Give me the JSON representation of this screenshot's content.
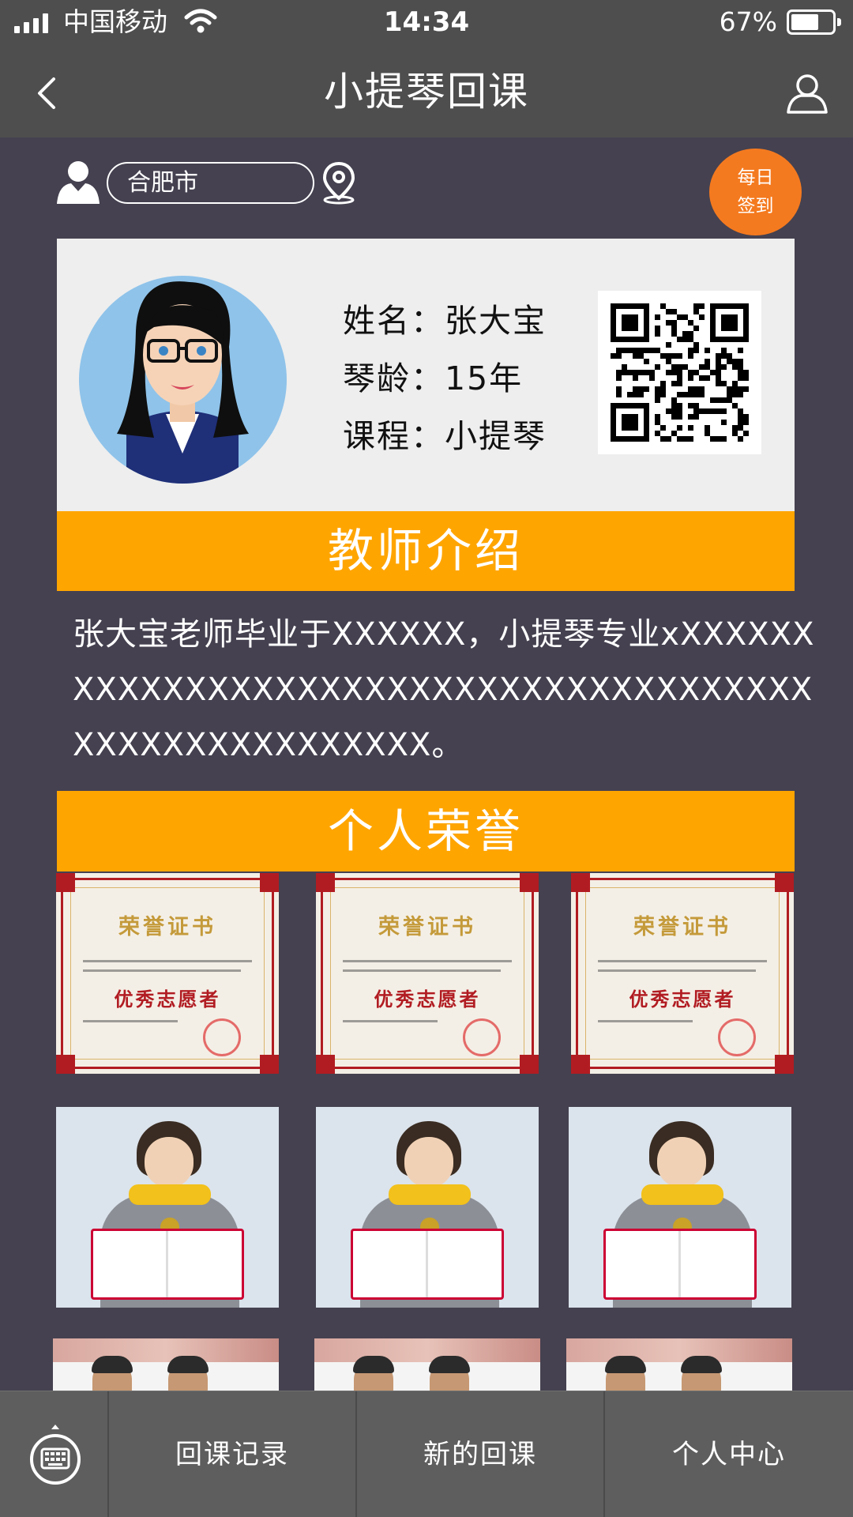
{
  "status_bar": {
    "carrier": "中国移动",
    "time": "14:34",
    "battery": "67%",
    "battery_level": 0.67
  },
  "nav": {
    "title": "小提琴回课",
    "back_icon": "chevron-left-icon",
    "profile_icon": "user-outline-icon"
  },
  "location": {
    "city": "合肥市",
    "user_icon": "user-solid-icon",
    "pin_icon": "location-pin-icon"
  },
  "checkin": {
    "line1": "每日",
    "line2": "签到",
    "color": "#f47a1f"
  },
  "teacher": {
    "name_label": "姓名：",
    "name": "张大宝",
    "age_label": "琴龄：",
    "age": "15年",
    "course_label": "课程：",
    "course": "小提琴"
  },
  "intro": {
    "header": "教师介绍",
    "text": "张大宝老师毕业于XXXXXX，小提琴专业xXXXXXXXXXXXXXXXXXXXXXXXXXXXXXXXXXXXXXXXXXXXXXXXXXXXXXXX。"
  },
  "honors": {
    "header": "个人荣誉",
    "certificate_title": "荣誉证书",
    "certificate_award": "优秀志愿者"
  },
  "tabs": {
    "keyboard_icon": "keyboard-icon",
    "tab1": "回课记录",
    "tab2": "新的回课",
    "tab3": "个人中心"
  },
  "colors": {
    "background": "#454150",
    "bar": "#4e4e4e",
    "accent": "#ffa500",
    "tab_bar": "#5e5e5e"
  }
}
